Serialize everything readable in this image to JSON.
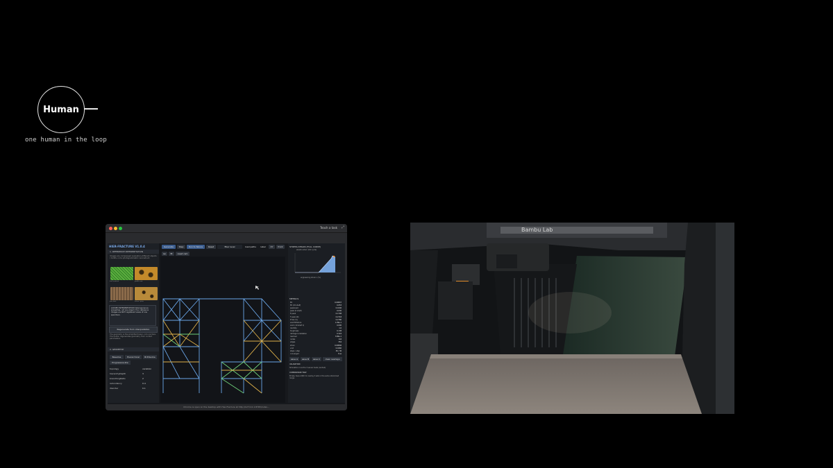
{
  "human": {
    "label": "Human",
    "caption": "one human in the loop"
  },
  "window": {
    "title_task": "Teach a task",
    "app": {
      "brand": "HIER-FRACTURE V1.0.4",
      "sections": {
        "reference": "1. REFERENCE INTERPRETATION",
        "geometry": "2. GEOMETRY"
      },
      "reference_note": "Images are compressed evaluation-different objects / motifs, not a photogrammetric reconstruct.",
      "textures": [
        {
          "label": "leaf venation",
          "color": "#3f8f2e"
        },
        {
          "label": "giraffe coat",
          "color": "#c48a2a"
        },
        {
          "label": "pine bark",
          "color": "#8a6a4a"
        },
        {
          "label": "lichen / plate",
          "color": "#b88a3a"
        }
      ],
      "locked_note": "LOCKED INTERPRETATION heterogeneous properties, not one object. Four reference images are NOT registered views of one specimen.",
      "regen_button": "Regenerate from interpretation",
      "geometry_note": "The geometry is the simplified tower, not a picture. The button regenerates geometry from current parameters.",
      "geometry_tabs": [
        "Baseline",
        "Hierarchical",
        "Brittle-like"
      ],
      "progressive_button": "Progressive-like",
      "params": [
        {
          "name": "topology",
          "value": "variation"
        },
        {
          "name": "hierarchyDepth",
          "value": "3"
        },
        {
          "name": "branchingRatio",
          "value": "2"
        },
        {
          "name": "redundancy",
          "value": "0.4"
        },
        {
          "name": "disorder",
          "value": "0.1"
        }
      ],
      "toolbar": [
        "Generate",
        "Step",
        "Run to failure",
        "Reset",
        "fiber level",
        "load paths",
        "label",
        "XY",
        "front"
      ],
      "toolbar2": [
        "iso",
        "fit",
        "reset cam"
      ],
      "stress_title": "STRESS-STRAIN (FULL CURVE)",
      "stress_subtitle": "elastic-return (full cycle)",
      "stress_xlabel": "engineering strain ε (%)",
      "metrics_title": "METRICS",
      "metrics": [
        {
          "name": "E0",
          "value": "0.00847"
        },
        {
          "name": "E0 (19 shelf)",
          "value": "0.053"
        },
        {
          "name": "peakLoad",
          "value": "0.1046"
        },
        {
          "name": "peak (0 shelf)",
          "value": "0.030"
        },
        {
          "name": "E peak",
          "value": "0.1708"
        },
        {
          "name": "F peak (N)",
          "value": "0.2718"
        },
        {
          "name": "E fail (%)",
          "value": "0.2780"
        },
        {
          "name": "workToFailure",
          "value": "1.09e-1"
        },
        {
          "name": "work (19 shelf 1)",
          "value": "0.000"
        },
        {
          "name": "ductility",
          "value": "1.0"
        },
        {
          "name": "toughness",
          "value": "0.138"
        },
        {
          "name": "damage localization",
          "value": "0.324"
        },
        {
          "name": "residual",
          "value": "3.86e-1"
        },
        {
          "name": "nodes",
          "value": "144"
        },
        {
          "name": "edges",
          "value": "354"
        },
        {
          "name": "strain",
          "value": "0.00846"
        },
        {
          "name": "void",
          "value": "0.0460"
        },
        {
          "name": "steps / step",
          "value": "36 / 36"
        },
        {
          "name": "converged",
          "value": "true"
        }
      ],
      "save_buttons": [
        "save A",
        "save B",
        "save C",
        "clear overlays"
      ],
      "validation_title": "VALIDATION",
      "validation_text": "Simulation runs the 3 sensor tests (cached)",
      "comparison_title": "COMPARISON TRAY",
      "comparison_text": "Empty. Save A/B/C to overlay 3 sets in the same strain/load range."
    },
    "footer": "Chrome is open on the desktop with Hier-Fracture at http://127.0.0.1:8765/index..."
  },
  "camera": {
    "brand_text": "Bambu Lab",
    "label": "Bambu Lab"
  }
}
